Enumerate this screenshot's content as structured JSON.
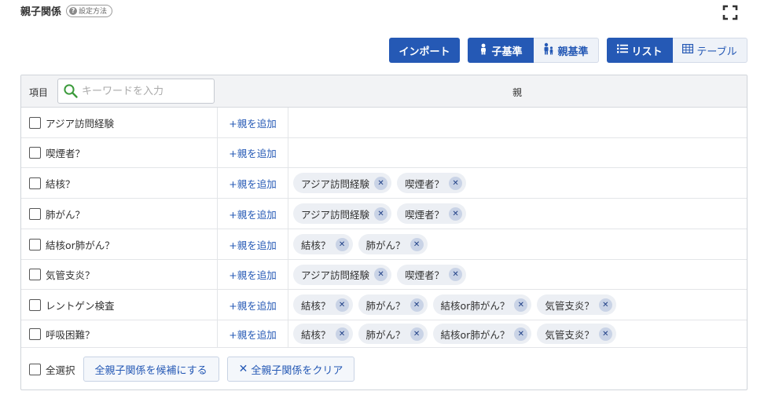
{
  "header": {
    "title": "親子関係",
    "howto_label": "設定方法",
    "howto_icon": "question-circle-icon",
    "fullscreen_icon": "fullscreen-icon"
  },
  "toolbar": {
    "import_label": "インポート",
    "child_based_label": "子基準",
    "parent_based_label": "親基準",
    "list_label": "リスト",
    "table_label": "テーブル"
  },
  "grid": {
    "item_column_label": "項目",
    "search_placeholder": "キーワードを入力",
    "parent_column_label": "親",
    "add_parent_label": "+親を追加",
    "rows": [
      {
        "label": "アジア訪問経験",
        "parents": []
      },
      {
        "label": "喫煙者？",
        "parents": []
      },
      {
        "label": "結核？",
        "parents": [
          "アジア訪問経験",
          "喫煙者？"
        ]
      },
      {
        "label": "肺がん？",
        "parents": [
          "アジア訪問経験",
          "喫煙者？"
        ]
      },
      {
        "label": "結核or肺がん？",
        "parents": [
          "結核？",
          "肺がん？"
        ]
      },
      {
        "label": "気管支炎？",
        "parents": [
          "アジア訪問経験",
          "喫煙者？"
        ]
      },
      {
        "label": "レントゲン検査",
        "parents": [
          "結核？",
          "肺がん？",
          "結核or肺がん？",
          "気管支炎？"
        ]
      },
      {
        "label": "呼吸困難？",
        "parents": [
          "結核？",
          "肺がん？",
          "結核or肺がん？",
          "気管支炎？"
        ]
      }
    ]
  },
  "footer": {
    "select_all_label": "全選択",
    "set_all_candidates_label": "全親子関係を候補にする",
    "clear_all_label": "全親子関係をクリア"
  },
  "colors": {
    "primary": "#2559b5",
    "chip_bg": "#eceff4",
    "chip_x_bg": "#c9d3e6"
  }
}
